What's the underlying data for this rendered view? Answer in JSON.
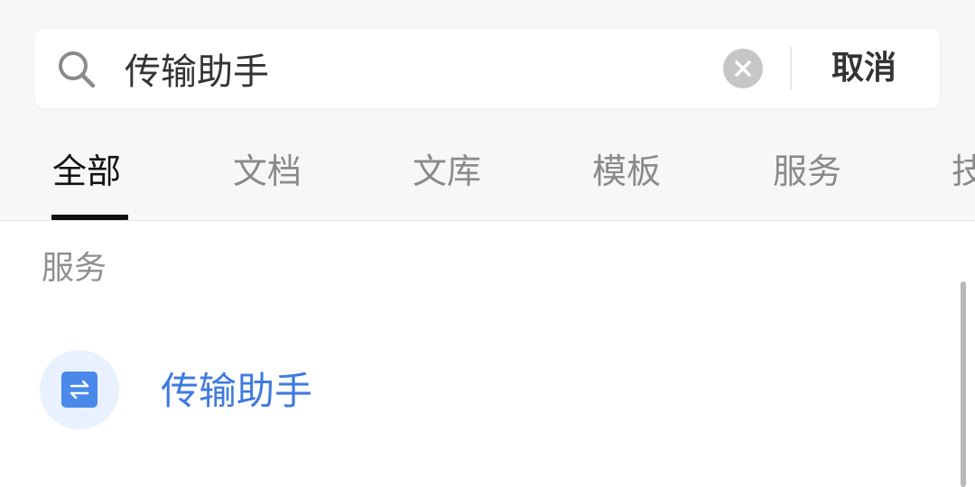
{
  "search": {
    "value": "传输助手",
    "cancel_label": "取消",
    "search_icon": "search-icon",
    "clear_icon": "close-icon"
  },
  "tabs": [
    {
      "label": "全部",
      "active": true
    },
    {
      "label": "文档",
      "active": false
    },
    {
      "label": "文库",
      "active": false
    },
    {
      "label": "模板",
      "active": false
    },
    {
      "label": "服务",
      "active": false
    },
    {
      "label": "技",
      "active": false
    }
  ],
  "sections": [
    {
      "title": "服务",
      "items": [
        {
          "label": "传输助手",
          "icon": "transfer-icon"
        }
      ]
    }
  ],
  "colors": {
    "accent": "#3f7ae0",
    "icon_bg": "#e8f1fd",
    "icon_fill": "#4a88ea",
    "tab_inactive": "#8a8a8a",
    "tab_active": "#111111"
  }
}
